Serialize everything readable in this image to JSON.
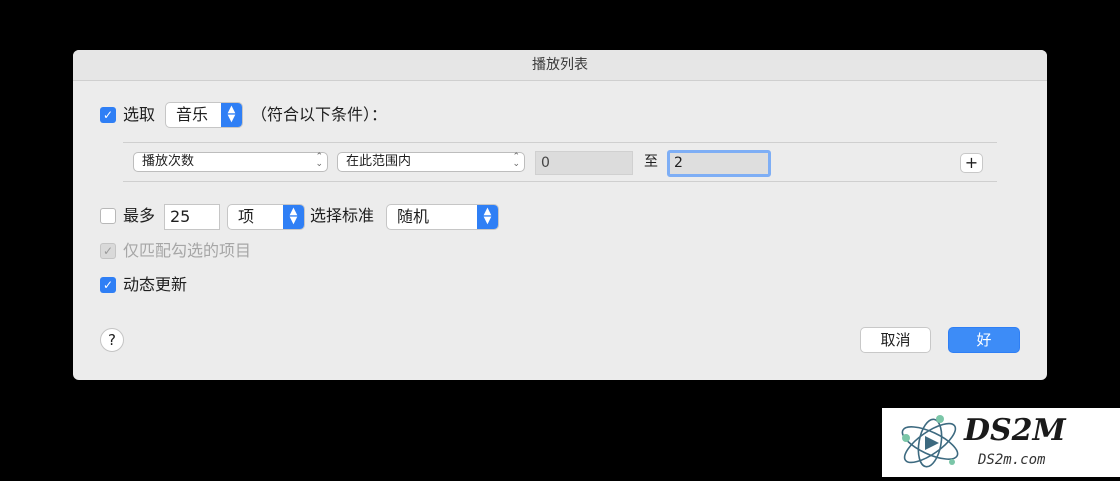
{
  "dialog": {
    "title": "播放列表"
  },
  "select_row": {
    "checkbox_checked": true,
    "label": "选取",
    "media_value": "音乐",
    "suffix": "（符合以下条件）："
  },
  "rule": {
    "field_value": "播放次数",
    "operator_value": "在此范围内",
    "from_value": "0",
    "to_label": "至",
    "to_value": "2",
    "add_label": "+"
  },
  "limit_row": {
    "checkbox_checked": false,
    "label": "最多",
    "count_value": "25",
    "unit_value": "项",
    "selected_by_label": "选择标准",
    "selected_by_value": "随机"
  },
  "match_checked": {
    "checkbox_checked": true,
    "disabled": true,
    "label": "仅匹配勾选的项目"
  },
  "live_update": {
    "checkbox_checked": true,
    "label": "动态更新"
  },
  "footer": {
    "help_label": "?",
    "cancel_label": "取消",
    "ok_label": "好"
  },
  "colors": {
    "accent": "#2f7ff5",
    "dialog_bg": "#ececec",
    "backdrop": "#000000"
  }
}
